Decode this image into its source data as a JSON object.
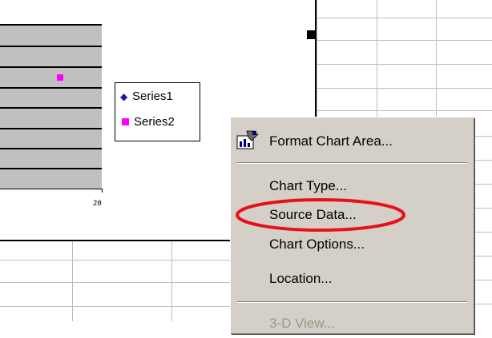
{
  "chart": {
    "legend": [
      {
        "label": "Series1",
        "color": "#1a1aa6",
        "marker": "diamond"
      },
      {
        "label": "Series2",
        "color": "#ff00ff",
        "marker": "square"
      }
    ],
    "x_tick_label": "20"
  },
  "context_menu": {
    "items": [
      {
        "label": "Format Chart Area...",
        "icon": "format-chart-area-icon",
        "enabled": true
      },
      {
        "label": "Chart Type...",
        "enabled": true
      },
      {
        "label": "Source Data...",
        "enabled": true,
        "highlighted": true
      },
      {
        "label": "Chart Options...",
        "enabled": true
      },
      {
        "label": "Location...",
        "enabled": true
      },
      {
        "label": "3-D View...",
        "enabled": false
      }
    ]
  },
  "annotation": {
    "color": "#e8101a",
    "shape": "ellipse",
    "target": "Source Data..."
  }
}
